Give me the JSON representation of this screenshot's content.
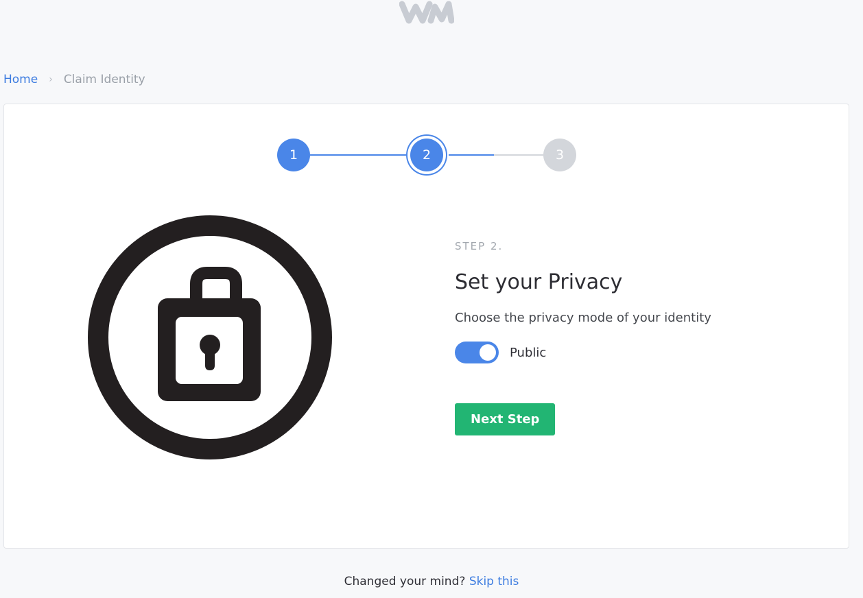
{
  "logo": {
    "icon": "wm-logo-icon",
    "color": "#c8ccd3"
  },
  "breadcrumb": {
    "home": "Home",
    "separator": "›",
    "current": "Claim Identity"
  },
  "stepper": {
    "steps": [
      "1",
      "2",
      "3"
    ],
    "current": 2,
    "active_color": "#4a86e8",
    "inactive_color": "#d3d6db"
  },
  "illustration": {
    "icon": "lock-circle-icon"
  },
  "content": {
    "step_label": "STEP 2.",
    "title": "Set your Privacy",
    "subtitle": "Choose the privacy mode of your identity",
    "toggle": {
      "on": true,
      "label": "Public"
    },
    "next_button": "Next Step",
    "button_color": "#22b573"
  },
  "footer": {
    "text": "Changed your mind?",
    "link": "Skip this"
  }
}
